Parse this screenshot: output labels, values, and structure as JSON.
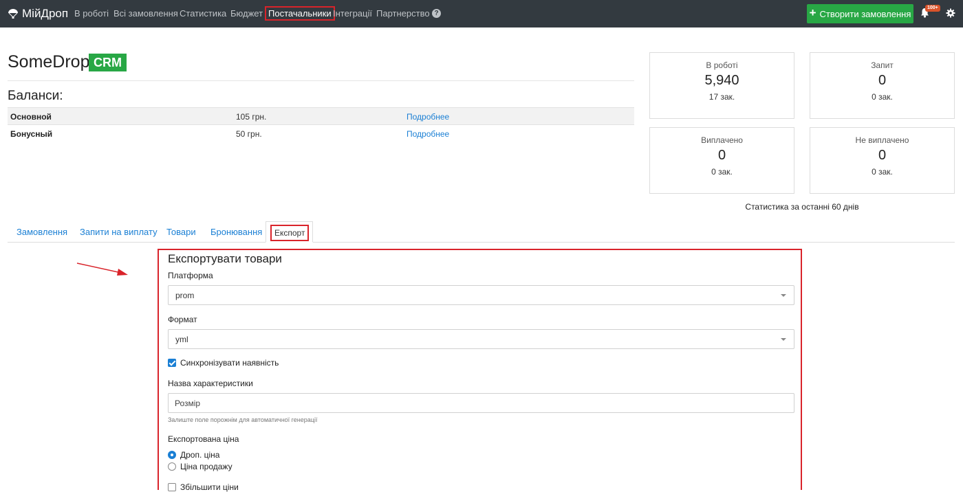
{
  "navbar": {
    "brand": "МійДроп",
    "links": [
      "В роботі",
      "Всі замовлення",
      "Статистика",
      "Бюджет",
      "Постачальники",
      "Інтеграції",
      "Партнерство"
    ],
    "active_link": "Постачальники",
    "create_button": "Створити замовлення",
    "notification_badge": "100+"
  },
  "header": {
    "title": "SomeDrop",
    "badge": "CRM"
  },
  "balances": {
    "heading": "Баланси:",
    "rows": [
      {
        "name": "Основной",
        "amount": "105 грн.",
        "link": "Подробнее"
      },
      {
        "name": "Бонусный",
        "amount": "50 грн.",
        "link": "Подробнее"
      }
    ]
  },
  "stats": {
    "cards": [
      {
        "label": "В роботі",
        "value": "5,940",
        "sub": "17 зак."
      },
      {
        "label": "Запит",
        "value": "0",
        "sub": "0 зак."
      },
      {
        "label": "Виплачено",
        "value": "0",
        "sub": "0 зак."
      },
      {
        "label": "Не виплачено",
        "value": "0",
        "sub": "0 зак."
      }
    ],
    "caption": "Статистика за останні 60 днів"
  },
  "tabs": {
    "items": [
      "Замовлення",
      "Запити на виплату",
      "Товари",
      "Бронювання",
      "Експорт"
    ],
    "active": "Експорт"
  },
  "export": {
    "title": "Експортувати товари",
    "platform_label": "Платформа",
    "platform_value": "prom",
    "format_label": "Формат",
    "format_value": "yml",
    "sync_label": "Синхронізувати наявність",
    "sync_checked": true,
    "attr_label": "Назва характеристики",
    "attr_value": "Розмір",
    "attr_hint": "Залиште поле порожнім для автоматичної генерації",
    "price_label": "Експортована ціна",
    "price_options": [
      "Дроп. ціна",
      "Ціна продажу"
    ],
    "price_selected": "Дроп. ціна",
    "increase_label": "Збільшити ціни",
    "increase_checked": false
  },
  "colors": {
    "navbar_bg": "#333a40",
    "accent_green": "#28a745",
    "link_blue": "#1a7fd4",
    "highlight_red": "#d9232a"
  }
}
